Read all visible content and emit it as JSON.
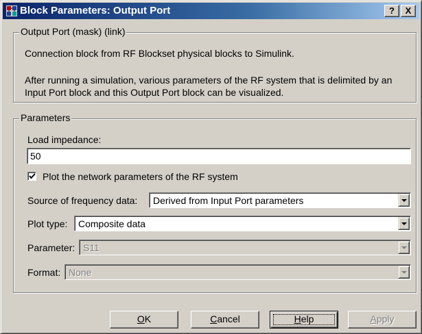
{
  "window": {
    "title": "Block Parameters: Output Port",
    "help_glyph": "?",
    "close_glyph": "X"
  },
  "description": {
    "legend": "Output Port (mask) (link)",
    "line1": "Connection block from RF Blockset physical blocks to Simulink.",
    "line2": "After running a simulation, various parameters of the RF system that is delimited by an",
    "line3": "Input Port block and this Output Port block can be visualized."
  },
  "parameters": {
    "legend": "Parameters",
    "load_impedance_label": "Load impedance:",
    "load_impedance_value": "50",
    "plot_checkbox_label": "Plot the network parameters of the RF system",
    "plot_checkbox_checked": true,
    "source_label": "Source of frequency data:",
    "source_value": "Derived from Input Port parameters",
    "plot_type_label": "Plot type:",
    "plot_type_value": "Composite data",
    "parameter_label": "Parameter:",
    "parameter_value": "S11",
    "format_label": "Format:",
    "format_value": "None"
  },
  "buttons": {
    "ok": {
      "mnemonic": "O",
      "rest": "K"
    },
    "cancel": {
      "mnemonic": "C",
      "rest": "ancel"
    },
    "help": {
      "mnemonic": "H",
      "rest": "elp"
    },
    "apply": {
      "mnemonic": "A",
      "rest": "pply"
    }
  },
  "colors": {
    "titlebar_start": "#0a246a",
    "titlebar_end": "#a6caf0",
    "face": "#d4d0c8"
  }
}
